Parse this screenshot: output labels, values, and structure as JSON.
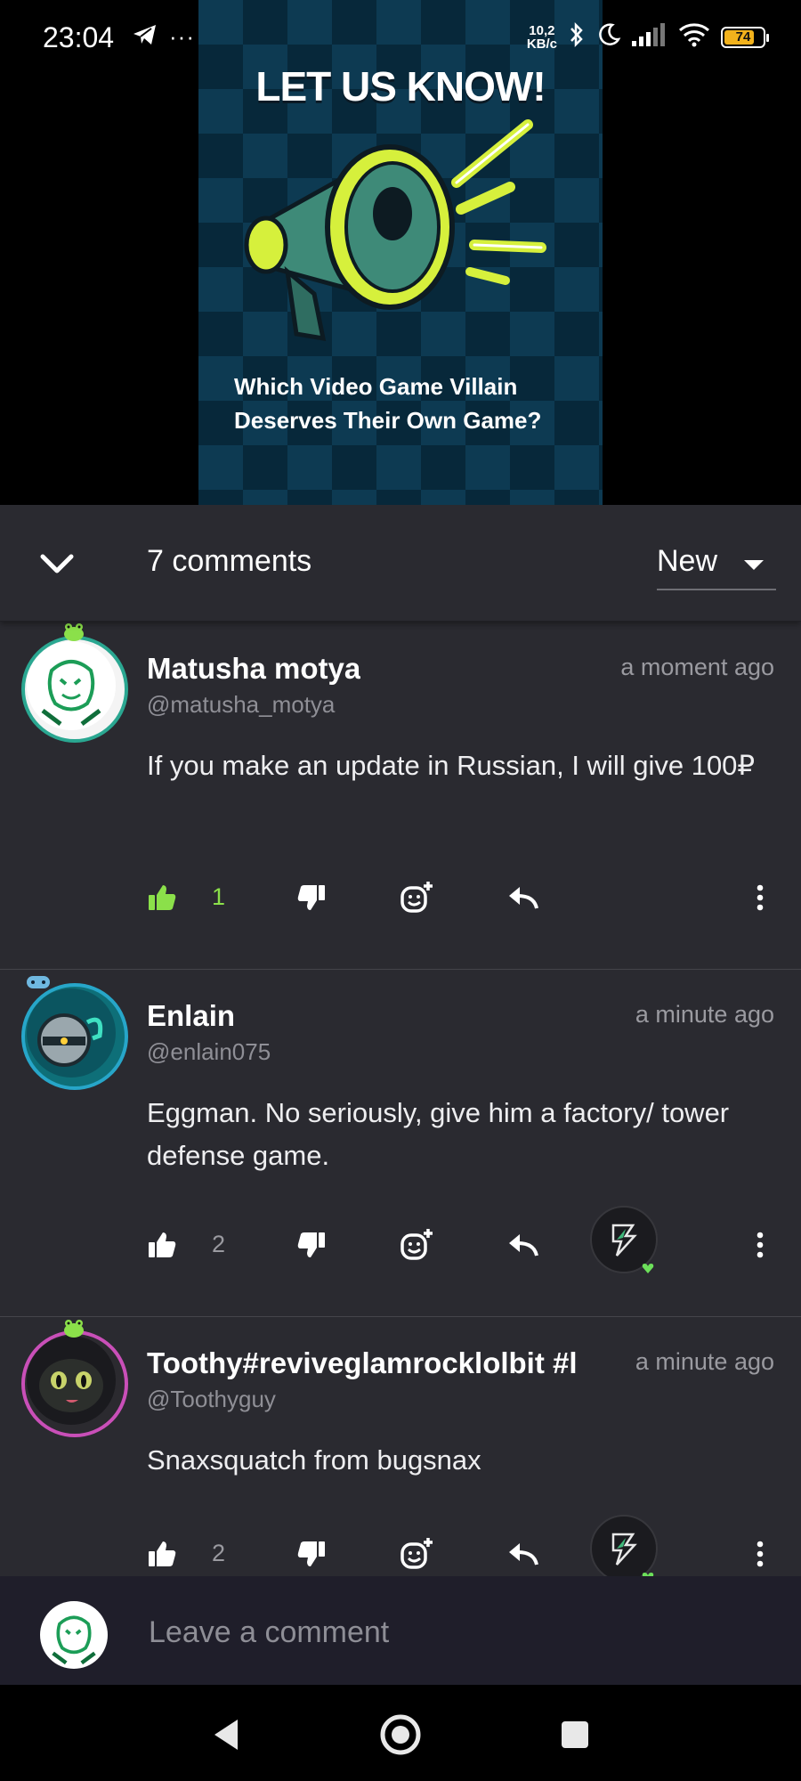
{
  "status_bar": {
    "time": "23:04",
    "overflow": "···",
    "net_speed_value": "10,2",
    "net_speed_unit": "KB/c",
    "battery_level": "74",
    "icons": [
      "telegram-icon",
      "bluetooth-icon",
      "moon-icon",
      "signal-icon",
      "wifi-icon",
      "battery-icon"
    ]
  },
  "video": {
    "title": "LET US KNOW!",
    "question_line1": "Which Video Game Villain",
    "question_line2": "Deserves Their Own Game?",
    "background_colors": [
      "#0d3a52",
      "#07283a"
    ],
    "accent_color": "#d6f03c"
  },
  "comments_header": {
    "count_label": "7 comments",
    "sort_selected": "New"
  },
  "comments": [
    {
      "username": "Matusha motya",
      "handle": "@matusha_motya",
      "timestamp": "a moment ago",
      "text": "If you make an update in Russian, I will give 100₽",
      "likes": "1",
      "liked": true,
      "has_award": false,
      "ring_color": "#2aa791"
    },
    {
      "username": "Enlain",
      "handle": "@enlain075",
      "timestamp": "a minute ago",
      "text": "Eggman. No seriously, give him a factory/ tower defense game.",
      "likes": "2",
      "liked": false,
      "has_award": true,
      "ring_color": "#27a6c9"
    },
    {
      "username": "Toothy#reviveglamrocklolbit #l",
      "handle": "@Toothyguy",
      "timestamp": "a minute ago",
      "text": "Snaxsquatch from bugsnax",
      "likes": "2",
      "liked": false,
      "has_award": true,
      "ring_color": "#c94fb8"
    }
  ],
  "composer": {
    "placeholder": "Leave a comment"
  },
  "colors": {
    "panel_bg": "#2a2a30",
    "like_active": "#8be04a",
    "muted_text": "#9a9aa0"
  }
}
